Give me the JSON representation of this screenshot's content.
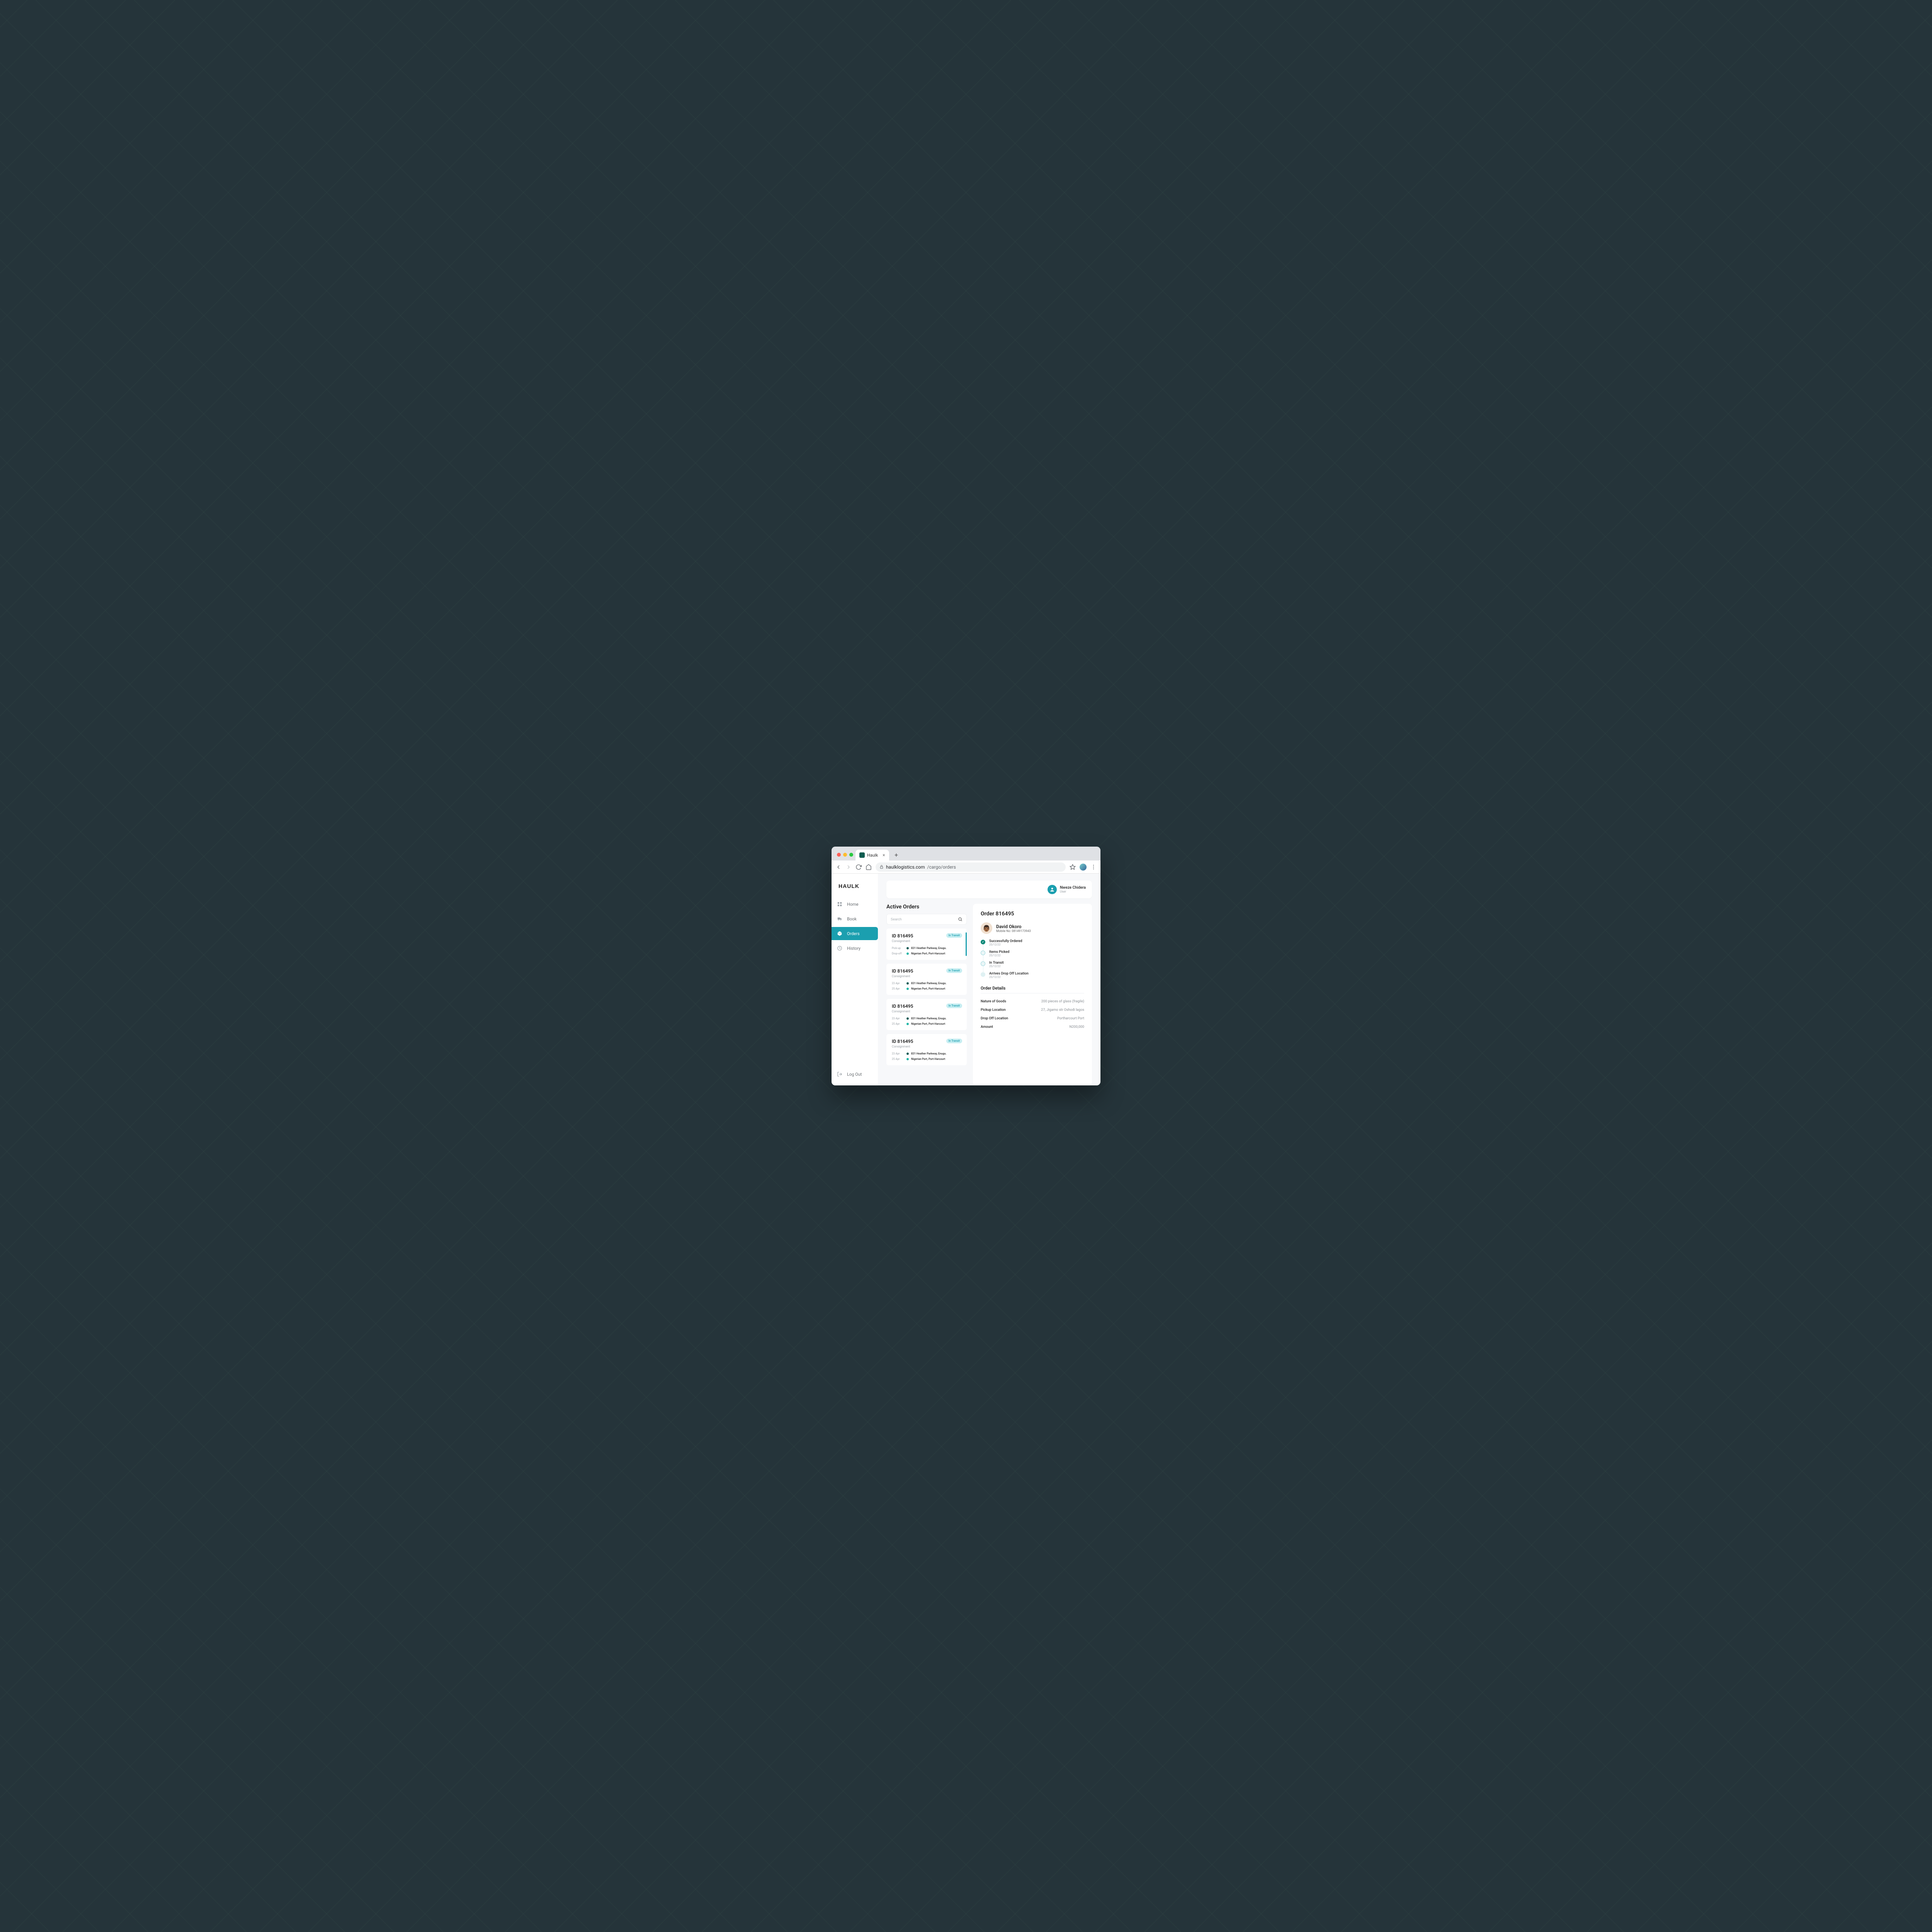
{
  "browser": {
    "tab_title": "Haulk",
    "url_host": "haulklogistics.com",
    "url_path": "/cargo/orders"
  },
  "brand": "HAULK",
  "user": {
    "name": "Nweze Chidera",
    "role": "User"
  },
  "nav": {
    "home": "Home",
    "book": "Book",
    "orders": "Orders",
    "history": "History",
    "logout": "Log Out"
  },
  "page": {
    "title": "Active Orders",
    "search_placeholder": "Search"
  },
  "orders": [
    {
      "id_label": "ID 816495",
      "type": "Consignment",
      "status": "In Transit",
      "row1_label": "Pick-up",
      "row1_addr": "831 Heather Parkway, Enugu.",
      "row2_label": "Drop-off",
      "row2_addr": "Nigerian Port, Port-Harcourt"
    },
    {
      "id_label": "ID 816495",
      "type": "Consignment",
      "status": "In Transit",
      "row1_label": "23 Apr",
      "row1_addr": "831 Heather Parkway, Enugu.",
      "row2_label": "25 Apr",
      "row2_addr": "Nigerian Port, Port-Harcourt"
    },
    {
      "id_label": "ID 816495",
      "type": "Consignment",
      "status": "In Transit",
      "row1_label": "23 Apr",
      "row1_addr": "831 Heather Parkway, Enugu.",
      "row2_label": "25 Apr",
      "row2_addr": "Nigerian Port, Port-Harcourt"
    },
    {
      "id_label": "ID 816495",
      "type": "Consignment",
      "status": "In Transit",
      "row1_label": "23 Apr",
      "row1_addr": "831 Heather Parkway, Enugu.",
      "row2_label": "25 Apr",
      "row2_addr": "Nigerian Port, Port-Harcourt"
    }
  ],
  "detail": {
    "title": "Order 816495",
    "driver": {
      "name": "David Okoro",
      "phone_label": "Mobile No: 08149173943"
    },
    "timeline": [
      {
        "title": "Successfully Ordered",
        "date": "25/12/22",
        "state": "done"
      },
      {
        "title": "Items Picked",
        "date": "25/12/22",
        "state": "pending"
      },
      {
        "title": "In Transit",
        "date": "25/12/22",
        "state": "pending"
      },
      {
        "title": "Arrives Drop Off Location",
        "date": "25/12/22",
        "state": "future"
      }
    ],
    "section_title": "Order Details",
    "rows": [
      {
        "k": "Nature of Goods",
        "v": "200 pieces of glass (fragile)"
      },
      {
        "k": "Pickup Location",
        "v": "27, Jigamo str Oshodi lagos"
      },
      {
        "k": "Drop Off Location",
        "v": "Portharcourt Port"
      },
      {
        "k": "Amount",
        "v": "N200,000"
      }
    ]
  }
}
